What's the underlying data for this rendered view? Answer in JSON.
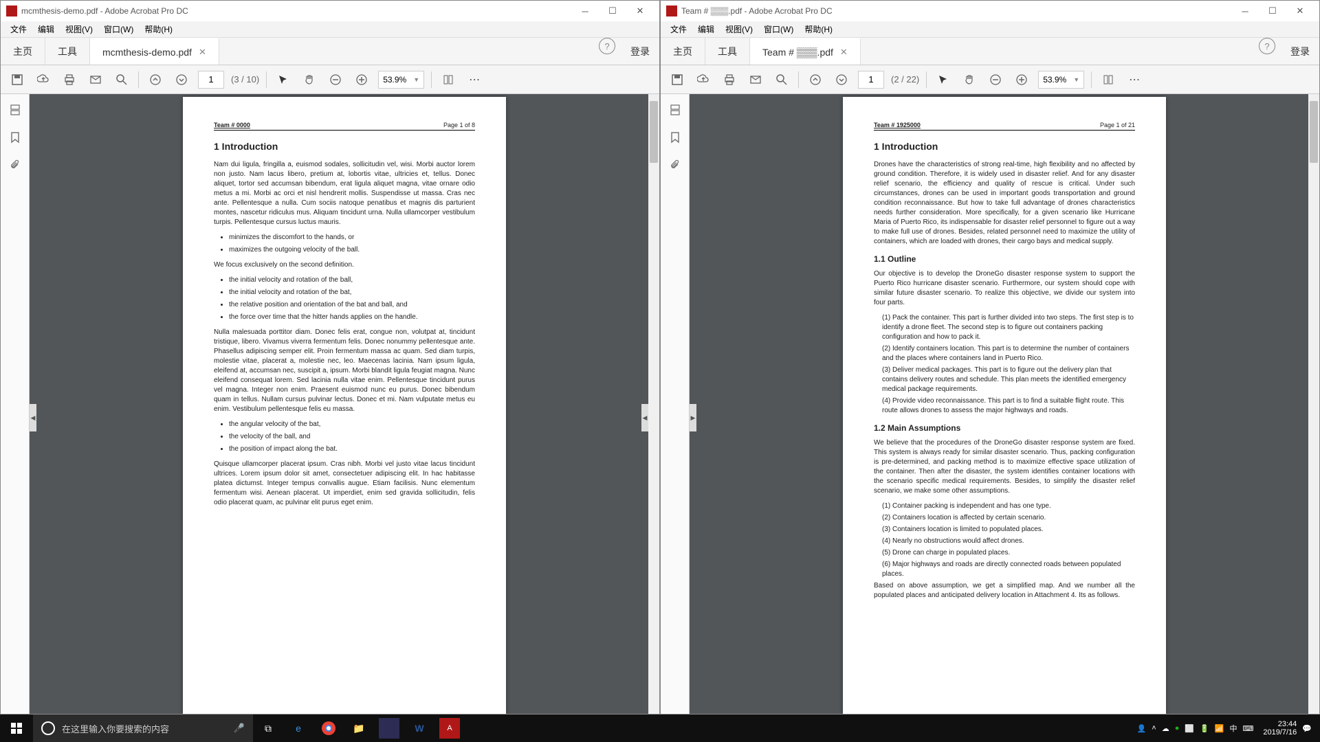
{
  "left": {
    "title": "mcmthesis-demo.pdf - Adobe Acrobat Pro DC",
    "menu": [
      "文件",
      "编辑",
      "视图(V)",
      "窗口(W)",
      "帮助(H)"
    ],
    "tabs": {
      "home": "主页",
      "tools": "工具",
      "doc": "mcmthesis-demo.pdf"
    },
    "login": "登录",
    "page_current": "1",
    "page_total": "(3 / 10)",
    "zoom": "53.9%",
    "doc": {
      "team": "Team # 0000",
      "pageof": "Page 1 of 8",
      "h1": "1   Introduction",
      "p1": "Nam dui ligula, fringilla a, euismod sodales, sollicitudin vel, wisi. Morbi auctor lorem non justo. Nam lacus libero, pretium at, lobortis vitae, ultricies et, tellus. Donec aliquet, tortor sed accumsan bibendum, erat ligula aliquet magna, vitae ornare odio metus a mi. Morbi ac orci et nisl hendrerit mollis. Suspendisse ut massa. Cras nec ante. Pellentesque a nulla. Cum sociis natoque penatibus et magnis dis parturient montes, nascetur ridiculus mus. Aliquam tincidunt urna. Nulla ullamcorper vestibulum turpis. Pellentesque cursus luctus mauris.",
      "b1": [
        "minimizes the discomfort to the hands, or",
        "maximizes the outgoing velocity of the ball."
      ],
      "p2": "We focus exclusively on the second definition.",
      "b2": [
        "the initial velocity and rotation of the ball,",
        "the initial velocity and rotation of the bat,",
        "the relative position and orientation of the bat and ball, and",
        "the force over time that the hitter hands applies on the handle."
      ],
      "p3": "Nulla malesuada porttitor diam. Donec felis erat, congue non, volutpat at, tincidunt tristique, libero. Vivamus viverra fermentum felis. Donec nonummy pellentesque ante. Phasellus adipiscing semper elit. Proin fermentum massa ac quam. Sed diam turpis, molestie vitae, placerat a, molestie nec, leo. Maecenas lacinia. Nam ipsum ligula, eleifend at, accumsan nec, suscipit a, ipsum. Morbi blandit ligula feugiat magna. Nunc eleifend consequat lorem. Sed lacinia nulla vitae enim. Pellentesque tincidunt purus vel magna. Integer non enim. Praesent euismod nunc eu purus. Donec bibendum quam in tellus. Nullam cursus pulvinar lectus. Donec et mi. Nam vulputate metus eu enim. Vestibulum pellentesque felis eu massa.",
      "b3": [
        "the angular velocity of the bat,",
        "the velocity of the ball, and",
        "the position of impact along the bat."
      ],
      "p4": "Quisque ullamcorper placerat ipsum. Cras nibh. Morbi vel justo vitae lacus tincidunt ultrices. Lorem ipsum dolor sit amet, consectetuer adipiscing elit. In hac habitasse platea dictumst. Integer tempus convallis augue. Etiam facilisis. Nunc elementum fermentum wisi. Aenean placerat. Ut imperdiet, enim sed gravida sollicitudin, felis odio placerat quam, ac pulvinar elit purus eget enim."
    }
  },
  "right": {
    "title": "Team # ▒▒▒.pdf - Adobe Acrobat Pro DC",
    "menu": [
      "文件",
      "编辑",
      "视图(V)",
      "窗口(W)",
      "帮助(H)"
    ],
    "tabs": {
      "home": "主页",
      "tools": "工具",
      "doc": "Team # ▒▒▒.pdf"
    },
    "login": "登录",
    "page_current": "1",
    "page_total": "(2 / 22)",
    "zoom": "53.9%",
    "doc": {
      "team": "Team # 1925000",
      "pageof": "Page 1 of 21",
      "h1": "1   Introduction",
      "p1": "Drones have the characteristics of strong real-time, high flexibility and no affected by ground condition. Therefore, it is widely used in disaster relief. And for any disaster relief scenario, the efficiency and quality of rescue is critical. Under such circumstances, drones can be used in important goods transportation and ground condition reconnaissance. But how to take full advantage of drones characteristics needs further consideration. More specifically, for a given scenario like Hurricane Maria of Puerto Rico, its indispensable for disaster relief personnel to figure out a way to make full use of drones. Besides, related personnel need to maximize the utility of containers, which are loaded with drones, their cargo bays and medical supply.",
      "h11": "1.1   Outline",
      "p2": "Our objective is to develop the DroneGo disaster response system to support the Puerto Rico hurricane disaster scenario. Furthermore, our system should cope with similar future disaster scenario. To realize this objective, we divide our system into four parts.",
      "n1": [
        "(1) Pack the container. This part is further divided into two steps. The first step is to identify a drone fleet. The second step is to figure out containers packing configuration and how to pack it.",
        "(2) Identify containers location. This part is to determine the number of containers and the places where containers land in Puerto Rico.",
        "(3) Deliver medical packages. This part is to figure out the delivery plan that contains delivery routes and schedule. This plan meets the identified emergency medical package requirements.",
        "(4) Provide video reconnaissance. This part is to find a suitable flight route. This route allows drones to assess the major highways and roads."
      ],
      "h12": "1.2   Main Assumptions",
      "p3": "We believe that the procedures of the DroneGo disaster response system are fixed. This system is always ready for similar disaster scenario. Thus, packing configuration is pre-determined, and packing method is to maximize effective space utilization of the container. Then after the disaster, the system identifies container locations with the scenario specific medical requirements. Besides, to simplify the disaster relief scenario, we make some other assumptions.",
      "n2": [
        "(1) Container packing is independent and has one type.",
        "(2) Containers location is affected by certain scenario.",
        "(3) Containers location is limited to populated places.",
        "(4) Nearly no obstructions would affect drones.",
        "(5) Drone can charge in populated places.",
        "(6) Major highways and roads are directly connected roads between populated places."
      ],
      "p4": "Based on above assumption, we get a simplified map. And we number all the populated places and anticipated delivery location in Attachment 4. Its as follows."
    }
  },
  "taskbar": {
    "search_placeholder": "在这里输入你要搜索的内容",
    "time": "23:44",
    "date": "2019/7/16"
  }
}
